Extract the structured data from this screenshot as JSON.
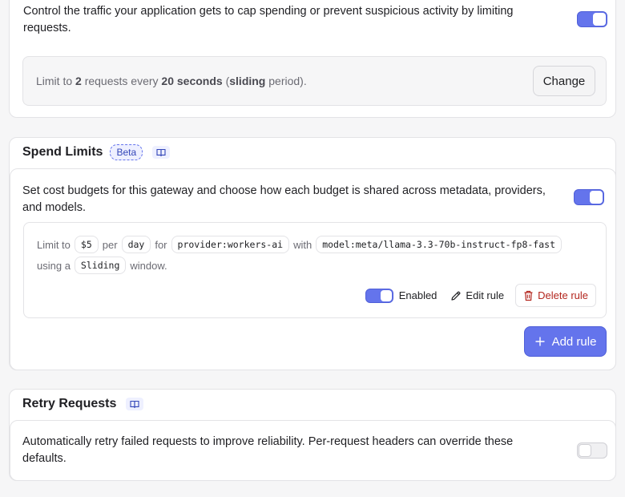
{
  "rate_limiting": {
    "description": "Control the traffic your application gets to cap spending or prevent suspicious activity by limiting requests.",
    "toggle_on": true,
    "summary": {
      "prefix": "Limit to ",
      "count": "2",
      "mid1": " requests every ",
      "duration": "20 seconds",
      "mid2": " (",
      "mode": "sliding",
      "suffix": " period)."
    },
    "change_label": "Change"
  },
  "spend_limits": {
    "title": "Spend Limits",
    "badge": "Beta",
    "docs_icon": "book-icon",
    "description": "Set cost budgets for this gateway and choose how each budget is shared across metadata, providers, and models.",
    "toggle_on": true,
    "rule": {
      "limit_to": "Limit to",
      "amount": "$5",
      "per": "per",
      "period": "day",
      "for": "for",
      "provider": "provider:workers-ai",
      "with": "with",
      "model": "model:meta/llama-3.3-70b-instruct-fp8-fast",
      "using_a": "using a",
      "window_type": "Sliding",
      "window": "window.",
      "enabled_label": "Enabled",
      "enabled": true,
      "edit_label": "Edit rule",
      "delete_label": "Delete rule"
    },
    "add_rule_label": "Add rule"
  },
  "retry_requests": {
    "title": "Retry Requests",
    "docs_icon": "book-icon",
    "description": "Automatically retry failed requests to improve reliability. Per-request headers can override these defaults.",
    "toggle_on": false
  },
  "colors": {
    "accent": "#6474ec",
    "danger": "#b3261e",
    "badge_bg": "#eef0ff"
  }
}
